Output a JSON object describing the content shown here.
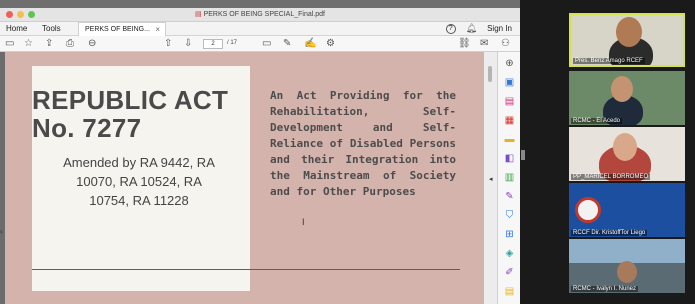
{
  "window": {
    "title": "PERKS OF BEING SPECIAL_Final.pdf"
  },
  "menubar": {
    "home": "Home",
    "tools": "Tools",
    "doc_tab": "PERKS OF BEING...",
    "doc_tab_close": "×",
    "help_icon": "?",
    "sign_in": "Sign In"
  },
  "toolbar": {
    "page_current": "2",
    "page_total": "/ 17"
  },
  "document": {
    "title_line1": "REPUBLIC ACT",
    "title_line2": "No. 7277",
    "amended": "Amended by RA 9442, RA 10070, RA 10524, RA 10754, RA 11228",
    "description": "An Act Providing for the Rehabilitation, Self-Development and Self-Reliance of Disabled Persons and their Integration into the Mainstream of Society",
    "description_last": "and for Other Purposes"
  },
  "participants": [
    {
      "name": "Pres. Benz Amago RCEF",
      "active": true
    },
    {
      "name": "RCMC - El Acedo",
      "active": false
    },
    {
      "name": "PP_MARICEL BORROMEO",
      "active": false
    },
    {
      "name": "RCCF Dir. KristoffTor Liego",
      "active": false
    },
    {
      "name": "RCMC - Ivalyn I. Nunez",
      "active": false
    }
  ],
  "colors": {
    "accent": "#d6e24b",
    "page_bg": "#d5b3ad",
    "panel_bg": "#f6f4ee"
  }
}
